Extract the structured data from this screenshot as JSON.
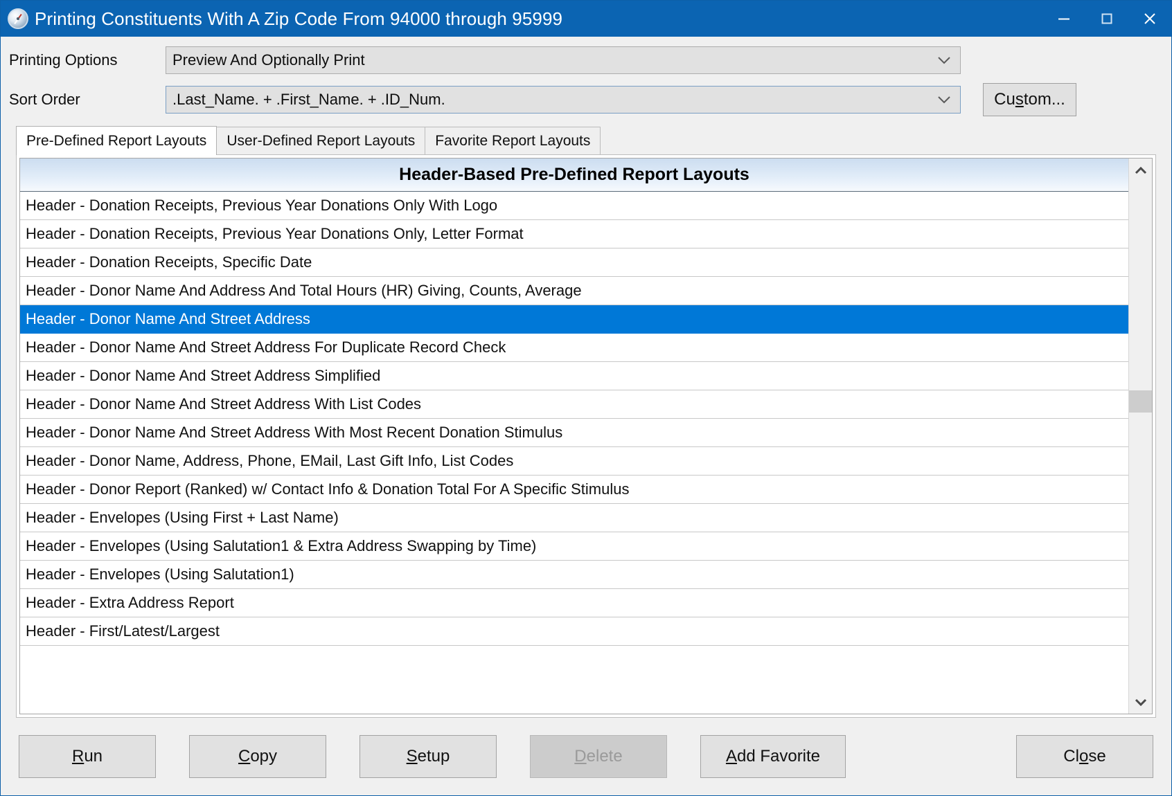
{
  "window": {
    "title": "Printing Constituents With A Zip Code From 94000 through 95999",
    "icon": "compass-icon",
    "accent_color": "#0b64b2",
    "selection_color": "#0078d7",
    "controls": {
      "minimize": "minimize-icon",
      "maximize": "maximize-icon",
      "close": "close-icon"
    }
  },
  "form": {
    "printing_options": {
      "label": "Printing Options",
      "value": "Preview And Optionally Print",
      "arrow": "chevron-down-icon"
    },
    "sort_order": {
      "label": "Sort Order",
      "value": ".Last_Name. + .First_Name. + .ID_Num.",
      "arrow": "chevron-down-icon"
    },
    "custom_button": {
      "pre": "Cu",
      "accel": "s",
      "post": "tom..."
    }
  },
  "tabs": [
    {
      "label": "Pre-Defined Report Layouts",
      "active": true
    },
    {
      "label": "User-Defined Report Layouts",
      "active": false
    },
    {
      "label": "Favorite Report Layouts",
      "active": false
    }
  ],
  "list": {
    "header": "Header-Based Pre-Defined Report Layouts",
    "selected_index": 4,
    "rows": [
      "Header - Donation Receipts, Previous Year Donations Only With Logo",
      "Header - Donation Receipts, Previous Year Donations Only, Letter Format",
      "Header - Donation Receipts, Specific Date",
      "Header - Donor Name And Address And Total Hours (HR) Giving, Counts, Average",
      "Header - Donor Name And Street Address",
      "Header - Donor Name And Street Address For Duplicate Record Check",
      "Header - Donor Name And Street Address Simplified",
      "Header - Donor Name And Street Address With List Codes",
      "Header - Donor Name And Street Address With Most Recent Donation Stimulus",
      "Header - Donor Name, Address, Phone, EMail, Last Gift Info, List Codes",
      "Header - Donor Report (Ranked) w/ Contact Info & Donation Total For A Specific Stimulus",
      "Header - Envelopes (Using First + Last Name)",
      "Header - Envelopes (Using Salutation1 & Extra Address Swapping by Time)",
      "Header - Envelopes (Using Salutation1)",
      "Header - Extra Address Report",
      "Header - First/Latest/Largest"
    ],
    "scrollbar": {
      "up_arrow": "chevron-up-icon",
      "down_arrow": "chevron-down-icon"
    }
  },
  "buttons": {
    "run": {
      "pre": "",
      "accel": "R",
      "post": "un",
      "disabled": false
    },
    "copy": {
      "pre": "",
      "accel": "C",
      "post": "opy",
      "disabled": false
    },
    "setup": {
      "pre": "",
      "accel": "S",
      "post": "etup",
      "disabled": false
    },
    "delete": {
      "pre": "",
      "accel": "D",
      "post": "elete",
      "disabled": true
    },
    "add_favorite": {
      "pre": "",
      "accel": "A",
      "post": "dd Favorite",
      "disabled": false
    },
    "close": {
      "pre": "Cl",
      "accel": "o",
      "post": "se",
      "disabled": false
    }
  }
}
